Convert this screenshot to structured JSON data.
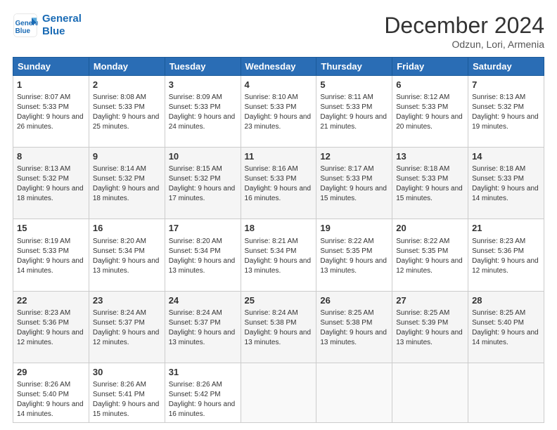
{
  "header": {
    "logo_line1": "General",
    "logo_line2": "Blue",
    "month": "December 2024",
    "location": "Odzun, Lori, Armenia"
  },
  "days_of_week": [
    "Sunday",
    "Monday",
    "Tuesday",
    "Wednesday",
    "Thursday",
    "Friday",
    "Saturday"
  ],
  "weeks": [
    [
      {
        "day": "1",
        "sr": "8:07 AM",
        "ss": "5:33 PM",
        "dl": "9 hours and 26 minutes."
      },
      {
        "day": "2",
        "sr": "8:08 AM",
        "ss": "5:33 PM",
        "dl": "9 hours and 25 minutes."
      },
      {
        "day": "3",
        "sr": "8:09 AM",
        "ss": "5:33 PM",
        "dl": "9 hours and 24 minutes."
      },
      {
        "day": "4",
        "sr": "8:10 AM",
        "ss": "5:33 PM",
        "dl": "9 hours and 23 minutes."
      },
      {
        "day": "5",
        "sr": "8:11 AM",
        "ss": "5:33 PM",
        "dl": "9 hours and 21 minutes."
      },
      {
        "day": "6",
        "sr": "8:12 AM",
        "ss": "5:33 PM",
        "dl": "9 hours and 20 minutes."
      },
      {
        "day": "7",
        "sr": "8:13 AM",
        "ss": "5:32 PM",
        "dl": "9 hours and 19 minutes."
      }
    ],
    [
      {
        "day": "8",
        "sr": "8:13 AM",
        "ss": "5:32 PM",
        "dl": "9 hours and 18 minutes."
      },
      {
        "day": "9",
        "sr": "8:14 AM",
        "ss": "5:32 PM",
        "dl": "9 hours and 18 minutes."
      },
      {
        "day": "10",
        "sr": "8:15 AM",
        "ss": "5:32 PM",
        "dl": "9 hours and 17 minutes."
      },
      {
        "day": "11",
        "sr": "8:16 AM",
        "ss": "5:33 PM",
        "dl": "9 hours and 16 minutes."
      },
      {
        "day": "12",
        "sr": "8:17 AM",
        "ss": "5:33 PM",
        "dl": "9 hours and 15 minutes."
      },
      {
        "day": "13",
        "sr": "8:18 AM",
        "ss": "5:33 PM",
        "dl": "9 hours and 15 minutes."
      },
      {
        "day": "14",
        "sr": "8:18 AM",
        "ss": "5:33 PM",
        "dl": "9 hours and 14 minutes."
      }
    ],
    [
      {
        "day": "15",
        "sr": "8:19 AM",
        "ss": "5:33 PM",
        "dl": "9 hours and 14 minutes."
      },
      {
        "day": "16",
        "sr": "8:20 AM",
        "ss": "5:34 PM",
        "dl": "9 hours and 13 minutes."
      },
      {
        "day": "17",
        "sr": "8:20 AM",
        "ss": "5:34 PM",
        "dl": "9 hours and 13 minutes."
      },
      {
        "day": "18",
        "sr": "8:21 AM",
        "ss": "5:34 PM",
        "dl": "9 hours and 13 minutes."
      },
      {
        "day": "19",
        "sr": "8:22 AM",
        "ss": "5:35 PM",
        "dl": "9 hours and 13 minutes."
      },
      {
        "day": "20",
        "sr": "8:22 AM",
        "ss": "5:35 PM",
        "dl": "9 hours and 12 minutes."
      },
      {
        "day": "21",
        "sr": "8:23 AM",
        "ss": "5:36 PM",
        "dl": "9 hours and 12 minutes."
      }
    ],
    [
      {
        "day": "22",
        "sr": "8:23 AM",
        "ss": "5:36 PM",
        "dl": "9 hours and 12 minutes."
      },
      {
        "day": "23",
        "sr": "8:24 AM",
        "ss": "5:37 PM",
        "dl": "9 hours and 12 minutes."
      },
      {
        "day": "24",
        "sr": "8:24 AM",
        "ss": "5:37 PM",
        "dl": "9 hours and 13 minutes."
      },
      {
        "day": "25",
        "sr": "8:24 AM",
        "ss": "5:38 PM",
        "dl": "9 hours and 13 minutes."
      },
      {
        "day": "26",
        "sr": "8:25 AM",
        "ss": "5:38 PM",
        "dl": "9 hours and 13 minutes."
      },
      {
        "day": "27",
        "sr": "8:25 AM",
        "ss": "5:39 PM",
        "dl": "9 hours and 13 minutes."
      },
      {
        "day": "28",
        "sr": "8:25 AM",
        "ss": "5:40 PM",
        "dl": "9 hours and 14 minutes."
      }
    ],
    [
      {
        "day": "29",
        "sr": "8:26 AM",
        "ss": "5:40 PM",
        "dl": "9 hours and 14 minutes."
      },
      {
        "day": "30",
        "sr": "8:26 AM",
        "ss": "5:41 PM",
        "dl": "9 hours and 15 minutes."
      },
      {
        "day": "31",
        "sr": "8:26 AM",
        "ss": "5:42 PM",
        "dl": "9 hours and 16 minutes."
      },
      null,
      null,
      null,
      null
    ]
  ]
}
